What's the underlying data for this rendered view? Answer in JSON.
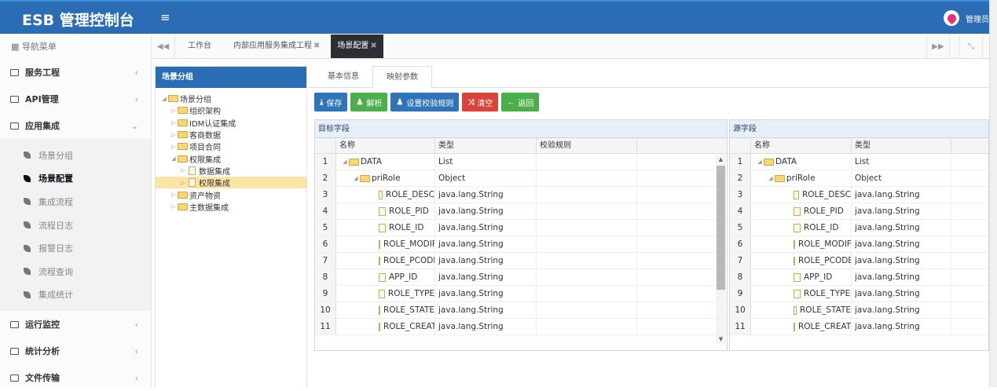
{
  "header": {
    "title": "ESB 管理控制台",
    "menu_icon": "≡",
    "user": "管理员"
  },
  "sidebar": {
    "title": "导航菜单",
    "items": [
      {
        "label": "服务工程",
        "expanded": false
      },
      {
        "label": "API管理",
        "expanded": false
      },
      {
        "label": "应用集成",
        "expanded": true,
        "children": [
          "场景分组",
          "场景配置",
          "集成流程",
          "流程日志",
          "报警日志",
          "流程查询",
          "集成统计"
        ],
        "active_child": "场景配置"
      },
      {
        "label": "运行监控",
        "expanded": false
      },
      {
        "label": "统计分析",
        "expanded": false
      },
      {
        "label": "文件传输",
        "expanded": false
      }
    ]
  },
  "page_tabs": [
    {
      "label": "工作台",
      "closable": false
    },
    {
      "label": "内部应用服务集成工程",
      "closable": true
    },
    {
      "label": "场景配置",
      "closable": true,
      "active": true
    }
  ],
  "tree": {
    "title": "场景分组",
    "nodes": [
      {
        "label": "场景分组",
        "level": 0,
        "type": "folder",
        "open": true
      },
      {
        "label": "组织架构",
        "level": 1,
        "type": "folder"
      },
      {
        "label": "IDM认证集成",
        "level": 1,
        "type": "folder"
      },
      {
        "label": "客商数据",
        "level": 1,
        "type": "folder"
      },
      {
        "label": "项目合同",
        "level": 1,
        "type": "folder"
      },
      {
        "label": "权限集成",
        "level": 1,
        "type": "folder",
        "open": true
      },
      {
        "label": "数据集成",
        "level": 2,
        "type": "file"
      },
      {
        "label": "权限集成",
        "level": 2,
        "type": "file",
        "selected": true
      },
      {
        "label": "资产物资",
        "level": 1,
        "type": "folder"
      },
      {
        "label": "主数据集成",
        "level": 1,
        "type": "folder"
      }
    ]
  },
  "sub_tabs": [
    {
      "label": "基本信息"
    },
    {
      "label": "映射参数",
      "active": true
    }
  ],
  "toolbar": {
    "save": "保存",
    "parse": "解析",
    "set_rule": "设置校验规则",
    "clear": "清空",
    "back": "返回"
  },
  "colors": {
    "header": "#2a6db5",
    "blue_btn": "#2f73b8",
    "green_btn": "#4cae4c",
    "red_btn": "#d9433c",
    "selected_node": "#fbe5a6"
  },
  "target": {
    "title": "目标字段",
    "columns": [
      "名称",
      "类型",
      "校验规则"
    ]
  },
  "source": {
    "title": "源字段",
    "columns": [
      "名称",
      "类型"
    ]
  },
  "rows": [
    {
      "n": "1",
      "name": "DATA",
      "type": "List",
      "level": 0,
      "kind": "folder"
    },
    {
      "n": "2",
      "name": "priRole",
      "type": "Object",
      "level": 1,
      "kind": "folder"
    },
    {
      "n": "3",
      "name": "ROLE_DESC",
      "type": "java.lang.String",
      "level": 2,
      "kind": "file"
    },
    {
      "n": "4",
      "name": "ROLE_PID",
      "type": "java.lang.String",
      "level": 2,
      "kind": "file"
    },
    {
      "n": "5",
      "name": "ROLE_ID",
      "type": "java.lang.String",
      "level": 2,
      "kind": "file"
    },
    {
      "n": "6",
      "name": "ROLE_MODIF",
      "type": "java.lang.String",
      "level": 2,
      "kind": "file"
    },
    {
      "n": "7",
      "name": "ROLE_PCODE",
      "type": "java.lang.String",
      "level": 2,
      "kind": "file"
    },
    {
      "n": "8",
      "name": "APP_ID",
      "type": "java.lang.String",
      "level": 2,
      "kind": "file"
    },
    {
      "n": "9",
      "name": "ROLE_TYPE",
      "type": "java.lang.String",
      "level": 2,
      "kind": "file"
    },
    {
      "n": "10",
      "name": "ROLE_STATE",
      "type": "java.lang.String",
      "level": 2,
      "kind": "file"
    },
    {
      "n": "11",
      "name": "ROLE_CREAT",
      "type": "java.lang.String",
      "level": 2,
      "kind": "file"
    }
  ]
}
